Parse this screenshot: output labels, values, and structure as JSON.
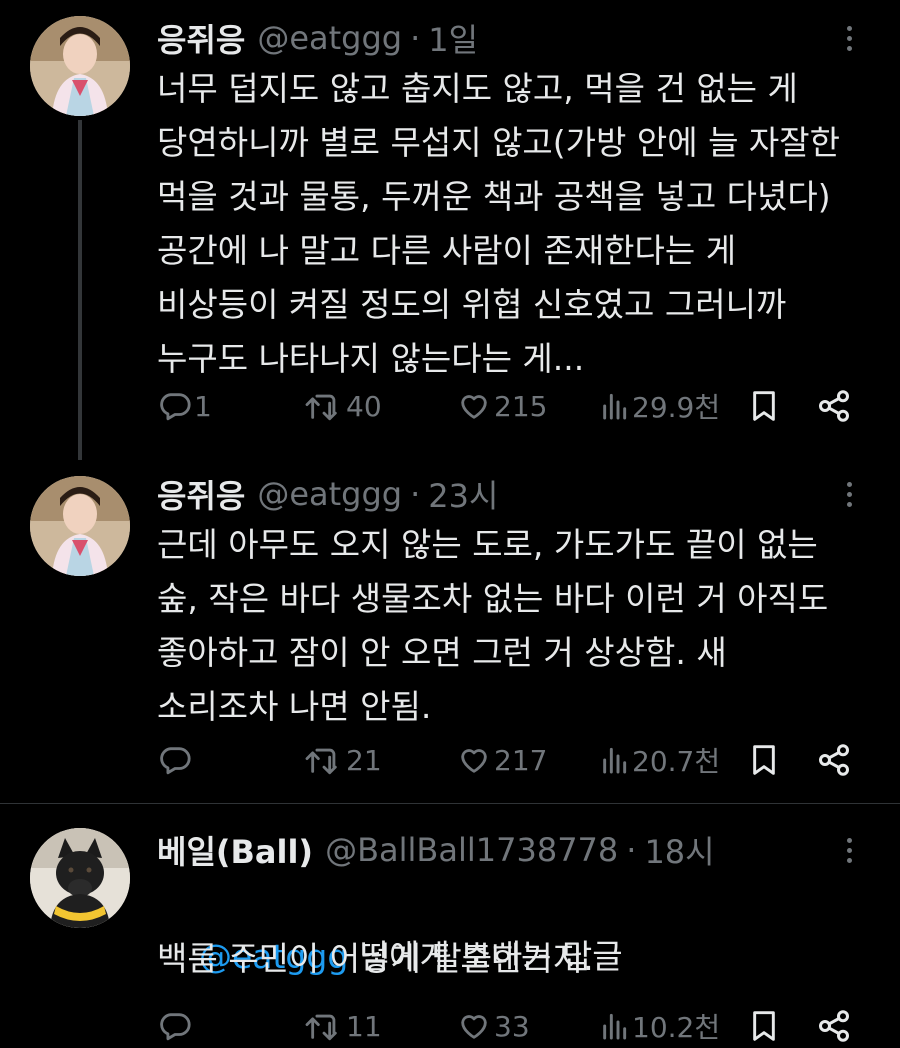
{
  "tweets": [
    {
      "name": "응쥐응",
      "handle": "@eatggg",
      "time": "1일",
      "text": "너무 덥지도 않고 춥지도 않고, 먹을 건 없는 게\n당연하니까 별로 무섭지 않고(가방 안에 늘 자잘한\n먹을 것과 물통, 두꺼운 책과 공책을 넣고 다녔다)\n공간에 나 말고 다른 사람이 존재한다는 게\n비상등이 켜질 정도의 위협 신호였고 그러니까\n누구도 나타나지 않는다는 게...",
      "replies": "1",
      "retweets": "40",
      "likes": "215",
      "views": "29.9천"
    },
    {
      "name": "응쥐응",
      "handle": "@eatggg",
      "time": "23시",
      "text": "근데 아무도 오지 않는 도로, 가도가도 끝이 없는\n숲, 작은 바다 생물조차 없는 바다 이런 거 아직도\n좋아하고 잠이 안 오면 그런 거 상상함. 새\n소리조차 나면 안됨.",
      "replies": "",
      "retweets": "21",
      "likes": "217",
      "views": "20.7천"
    },
    {
      "name": "베일(Ball)",
      "handle": "@BallBall1738778",
      "time": "18시",
      "reply_mention": "@eatggg",
      "reply_suffix": " 님에게 보내는 답글",
      "text": "백룸 주민이 어떻게 탈출한거지.",
      "replies": "",
      "retweets": "11",
      "likes": "33",
      "views": "10.2천"
    }
  ],
  "header_dot": "·",
  "icons": [
    "reply-icon",
    "retweet-icon",
    "like-icon",
    "views-icon",
    "bookmark-icon",
    "share-icon",
    "more-icon"
  ],
  "colors": {
    "background": "#000000",
    "text": "#e7e9ea",
    "muted": "#71767b",
    "link": "#1d9bf0",
    "divider": "#2f3336"
  }
}
